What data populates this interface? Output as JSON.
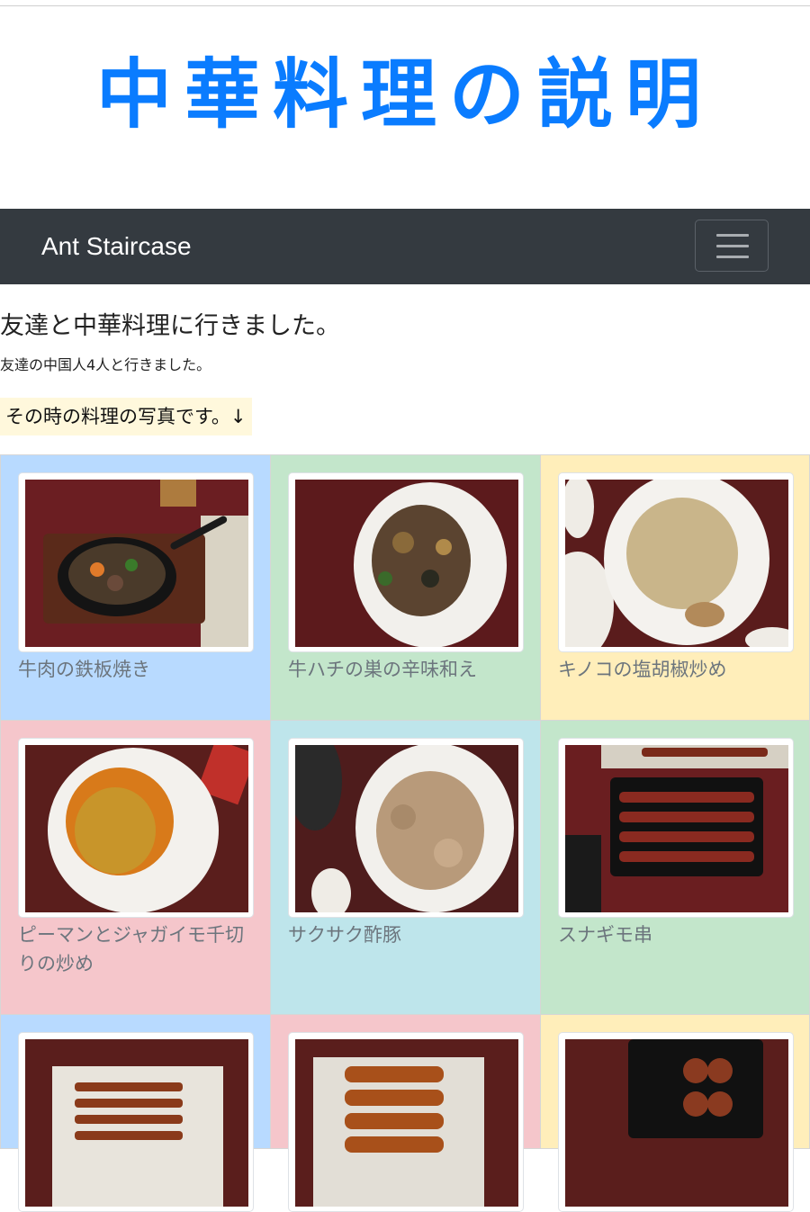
{
  "header": {
    "title": "中華料理の説明"
  },
  "navbar": {
    "brand": "Ant Staircase",
    "toggler_icon": "hamburger-icon"
  },
  "main": {
    "heading": "友達と中華料理に行きました。",
    "subtext": "友達の中国人4人と行きました。",
    "note": "その時の料理の写真です。↓"
  },
  "gallery": [
    {
      "caption": "牛肉の鉄板焼き",
      "bg": "#b8daff"
    },
    {
      "caption": "牛ハチの巣の辛味和え",
      "bg": "#c3e6cb"
    },
    {
      "caption": "キノコの塩胡椒炒め",
      "bg": "#ffeeba"
    },
    {
      "caption": "ピーマンとジャガイモ千切りの炒め",
      "bg": "#f5c6cb"
    },
    {
      "caption": "サクサク酢豚",
      "bg": "#bee5eb"
    },
    {
      "caption": "スナギモ串",
      "bg": "#c3e6cb"
    },
    {
      "caption": "",
      "bg": "#b8daff"
    },
    {
      "caption": "",
      "bg": "#f5c6cb"
    },
    {
      "caption": "",
      "bg": "#ffeeba"
    }
  ]
}
